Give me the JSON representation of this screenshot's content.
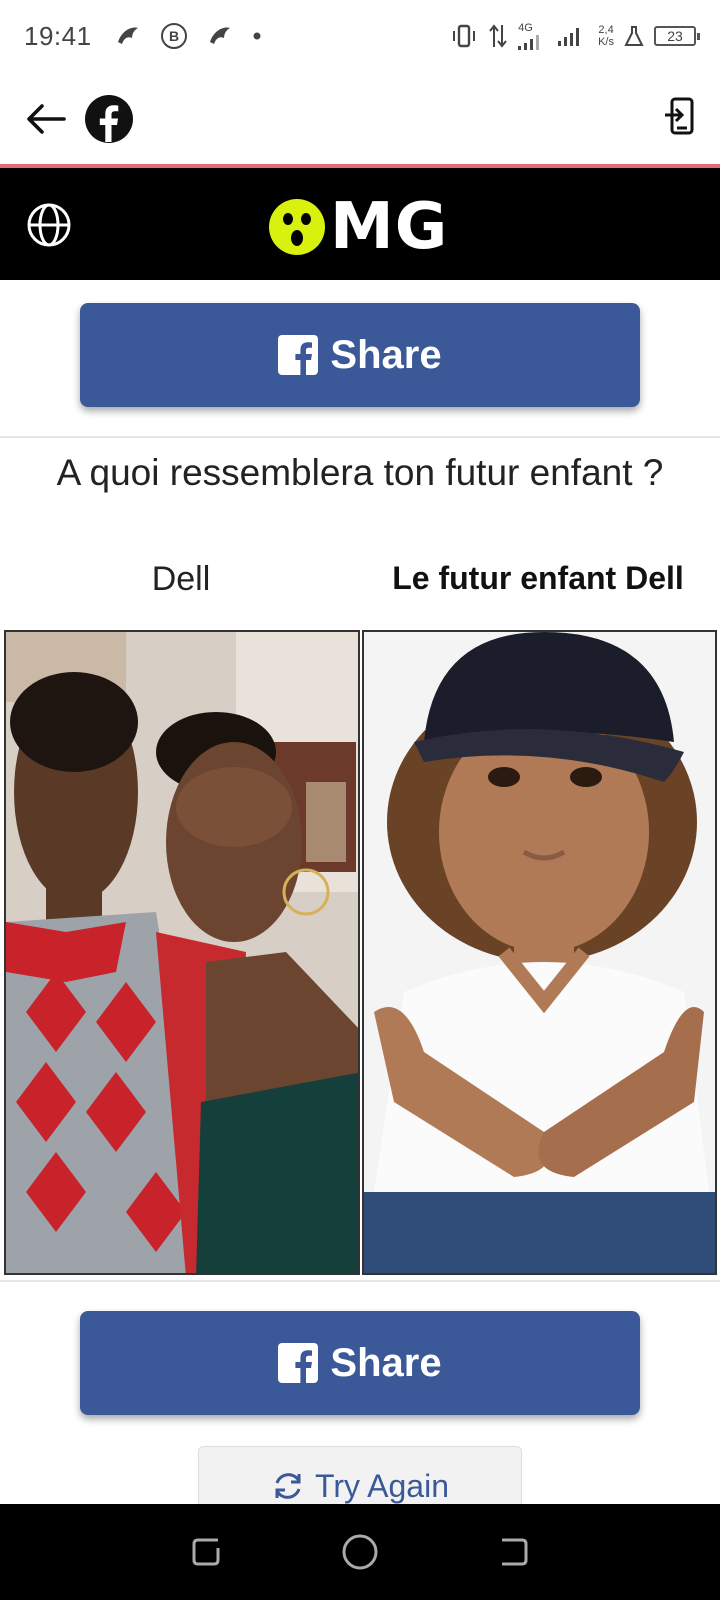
{
  "status_bar": {
    "time": "19:41",
    "network_label": "4G",
    "speed_value": "2,4",
    "speed_unit": "K/s",
    "battery": "23"
  },
  "app_bar": {
    "back_icon": "arrow-left-icon",
    "brand_icon": "facebook-icon",
    "action_icon": "open-external-icon"
  },
  "header": {
    "logo_text": "MG",
    "logo_accent_color": "#d9f20d",
    "globe_icon": "globe-icon"
  },
  "share": {
    "label": "Share",
    "color": "#3b5998"
  },
  "quiz": {
    "question": "A quoi ressemblera ton futur enfant ?",
    "left_label": "Dell",
    "right_label": "Le futur enfant Dell"
  },
  "try_again": {
    "label": "Try Again"
  }
}
